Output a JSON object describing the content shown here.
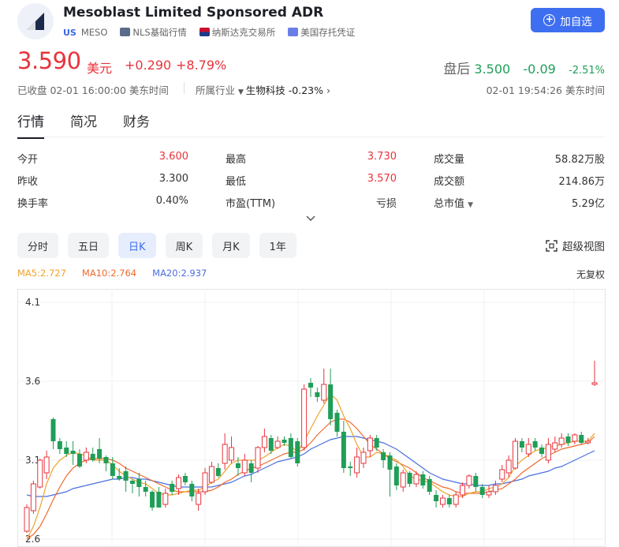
{
  "header": {
    "title": "Mesoblast Limited Sponsored ADR",
    "market_tag": "US",
    "ticker": "MESO",
    "tags": [
      "NLS基础行情",
      "纳斯达克交易所",
      "美国存托凭证"
    ],
    "fav_label": "加自选",
    "accent_color": "#3e6ff1"
  },
  "quote": {
    "price": "3.590",
    "unit": "美元",
    "change": "+0.290",
    "change_pct": "+8.79%",
    "after_label": "盘后",
    "after_price": "3.500",
    "after_change": "-0.09",
    "after_change_pct": "-2.51%",
    "closed_text": "已收盘 02-01 16:00:00 美东时间",
    "industry_label": "所属行业",
    "industry_name": "生物科技",
    "industry_change": "-0.23%",
    "after_time": "02-01 19:54:26 美东时间",
    "up_color": "#e8333c",
    "down_color": "#1f9e57"
  },
  "tabs": [
    "行情",
    "简况",
    "财务"
  ],
  "stats": [
    {
      "label": "今开",
      "value": "3.600"
    },
    {
      "label": "最高",
      "value": "3.730"
    },
    {
      "label": "成交量",
      "value": "58.82万股"
    },
    {
      "label": "昨收",
      "value": "3.300"
    },
    {
      "label": "最低",
      "value": "3.570"
    },
    {
      "label": "成交额",
      "value": "214.86万"
    },
    {
      "label": "换手率",
      "value": "0.40%"
    },
    {
      "label": "市盈(TTM)",
      "value": "亏损"
    },
    {
      "label": "总市值",
      "value": "5.29亿"
    }
  ],
  "periods": [
    "分时",
    "五日",
    "日K",
    "周K",
    "月K",
    "1年"
  ],
  "super_view": "超级视图",
  "ma": {
    "ma5": "MA5:2.727",
    "ma10": "MA10:2.764",
    "ma20": "MA20:2.937",
    "adjust": "无复权"
  },
  "chart_data": {
    "type": "candlestick",
    "y_ticks": [
      "4.1",
      "3.6",
      "3.1",
      "2.6"
    ],
    "ylim": [
      2.6,
      4.1
    ],
    "grid": true,
    "up_color": "#e8333c",
    "down_color": "#1f9e57",
    "ma_colors": {
      "ma5": "#f0a22b",
      "ma10": "#ef6a2d",
      "ma20": "#4b6fe0"
    },
    "candles": [
      [
        2.65,
        2.8,
        2.64,
        2.82
      ],
      [
        2.78,
        2.95,
        2.76,
        2.97
      ],
      [
        2.93,
        3.1,
        2.92,
        3.11
      ],
      [
        3.02,
        3.12,
        2.98,
        3.16
      ],
      [
        3.36,
        3.22,
        3.17,
        3.37
      ],
      [
        3.22,
        3.17,
        3.14,
        3.24
      ],
      [
        3.18,
        3.14,
        3.12,
        3.22
      ],
      [
        3.16,
        3.14,
        3.07,
        3.22
      ],
      [
        3.14,
        3.06,
        3.05,
        3.17
      ],
      [
        3.1,
        3.15,
        3.08,
        3.18
      ],
      [
        3.14,
        3.1,
        3.09,
        3.18
      ],
      [
        3.17,
        3.11,
        3.08,
        3.24
      ],
      [
        3.12,
        3.08,
        3.03,
        3.13
      ],
      [
        3.08,
        3.0,
        2.98,
        3.12
      ],
      [
        3.0,
        2.98,
        2.97,
        3.05
      ],
      [
        3.03,
        2.97,
        2.9,
        3.06
      ],
      [
        2.97,
        2.95,
        2.89,
        2.98
      ],
      [
        2.98,
        2.93,
        2.87,
        3.02
      ],
      [
        2.93,
        2.9,
        2.87,
        2.97
      ],
      [
        2.9,
        2.8,
        2.78,
        2.91
      ],
      [
        2.9,
        2.8,
        2.8,
        2.93
      ],
      [
        2.82,
        2.89,
        2.8,
        2.92
      ],
      [
        2.95,
        2.9,
        2.88,
        2.97
      ],
      [
        2.92,
        2.99,
        2.88,
        3.01
      ],
      [
        3.0,
        2.96,
        2.94,
        3.02
      ],
      [
        2.95,
        2.87,
        2.84,
        2.97
      ],
      [
        2.82,
        2.89,
        2.78,
        2.92
      ],
      [
        2.9,
        3.02,
        2.88,
        3.05
      ],
      [
        2.96,
        3.06,
        2.95,
        3.09
      ],
      [
        3.05,
        3.0,
        2.99,
        3.08
      ],
      [
        3.08,
        3.2,
        3.04,
        3.27
      ],
      [
        3.1,
        3.18,
        3.08,
        3.25
      ],
      [
        3.08,
        3.05,
        3.0,
        3.12
      ],
      [
        3.02,
        3.1,
        3.0,
        3.14
      ],
      [
        3.08,
        3.02,
        2.96,
        3.1
      ],
      [
        3.05,
        3.18,
        3.02,
        3.19
      ],
      [
        3.18,
        3.25,
        3.15,
        3.3
      ],
      [
        3.24,
        3.16,
        3.14,
        3.26
      ],
      [
        3.18,
        3.22,
        3.17,
        3.25
      ],
      [
        3.23,
        3.21,
        3.19,
        3.25
      ],
      [
        3.24,
        3.12,
        3.11,
        3.27
      ],
      [
        3.22,
        3.08,
        3.06,
        3.24
      ],
      [
        3.18,
        3.55,
        3.16,
        3.58
      ],
      [
        3.59,
        3.56,
        3.5,
        3.62
      ],
      [
        3.53,
        3.5,
        3.47,
        3.56
      ],
      [
        3.48,
        3.58,
        3.46,
        3.68
      ],
      [
        3.58,
        3.36,
        3.32,
        3.68
      ],
      [
        3.4,
        3.28,
        3.25,
        3.42
      ],
      [
        3.28,
        3.05,
        3.02,
        3.35
      ],
      [
        3.06,
        3.05,
        3.0,
        3.09
      ],
      [
        3.02,
        3.12,
        2.99,
        3.18
      ],
      [
        3.08,
        3.15,
        3.05,
        3.18
      ],
      [
        3.16,
        3.24,
        3.12,
        3.26
      ],
      [
        3.24,
        3.18,
        3.16,
        3.26
      ],
      [
        3.15,
        3.1,
        3.05,
        3.17
      ],
      [
        3.13,
        3.04,
        2.87,
        3.15
      ],
      [
        3.06,
        2.94,
        2.91,
        3.08
      ],
      [
        2.93,
        3.02,
        2.9,
        3.04
      ],
      [
        3.02,
        2.95,
        2.93,
        3.03
      ],
      [
        2.95,
        3.01,
        2.93,
        3.03
      ],
      [
        3.01,
        2.94,
        2.92,
        3.03
      ],
      [
        2.98,
        2.9,
        2.88,
        3.0
      ],
      [
        2.88,
        2.84,
        2.8,
        2.91
      ],
      [
        2.82,
        2.86,
        2.8,
        2.88
      ],
      [
        2.86,
        2.82,
        2.8,
        2.88
      ],
      [
        2.82,
        2.88,
        2.8,
        2.9
      ],
      [
        2.88,
        2.94,
        2.86,
        2.96
      ],
      [
        2.94,
        3.0,
        2.92,
        3.01
      ],
      [
        3.0,
        2.93,
        2.9,
        3.02
      ],
      [
        2.93,
        2.88,
        2.86,
        2.95
      ],
      [
        2.88,
        2.9,
        2.86,
        2.94
      ],
      [
        2.9,
        2.94,
        2.88,
        2.97
      ],
      [
        2.98,
        3.04,
        2.96,
        3.07
      ],
      [
        3.02,
        3.1,
        2.99,
        3.13
      ],
      [
        3.05,
        3.22,
        3.04,
        3.24
      ],
      [
        3.22,
        3.18,
        3.15,
        3.24
      ],
      [
        3.14,
        3.2,
        3.12,
        3.24
      ],
      [
        3.22,
        3.18,
        3.16,
        3.24
      ],
      [
        3.18,
        3.14,
        3.12,
        3.2
      ],
      [
        3.1,
        3.2,
        3.08,
        3.24
      ],
      [
        3.17,
        3.21,
        3.15,
        3.25
      ],
      [
        3.2,
        3.24,
        3.18,
        3.27
      ],
      [
        3.25,
        3.21,
        3.19,
        3.27
      ],
      [
        3.22,
        3.26,
        3.2,
        3.27
      ],
      [
        3.26,
        3.21,
        3.2,
        3.28
      ],
      [
        3.21,
        3.22,
        3.2,
        3.24
      ],
      [
        3.58,
        3.59,
        3.57,
        3.73
      ]
    ],
    "ma5": [
      2.6,
      2.68,
      2.8,
      2.95,
      3.05,
      3.1,
      3.13,
      3.15,
      3.14,
      3.13,
      3.1,
      3.1,
      3.1,
      3.07,
      3.03,
      3.0,
      2.98,
      2.96,
      2.95,
      2.92,
      2.89,
      2.88,
      2.88,
      2.89,
      2.9,
      2.91,
      2.91,
      2.93,
      2.96,
      2.98,
      3.03,
      3.08,
      3.1,
      3.1,
      3.1,
      3.1,
      3.12,
      3.15,
      3.18,
      3.2,
      3.19,
      3.15,
      3.22,
      3.3,
      3.38,
      3.45,
      3.52,
      3.48,
      3.38,
      3.3,
      3.2,
      3.12,
      3.12,
      3.15,
      3.14,
      3.12,
      3.1,
      3.06,
      3.0,
      2.98,
      2.97,
      2.96,
      2.93,
      2.9,
      2.88,
      2.87,
      2.87,
      2.89,
      2.9,
      2.9,
      2.92,
      2.93,
      2.95,
      2.99,
      3.06,
      3.1,
      3.13,
      3.16,
      3.17,
      3.18,
      3.19,
      3.2,
      3.21,
      3.22,
      3.22,
      3.22,
      3.27
    ],
    "ma10": [
      2.6,
      2.63,
      2.68,
      2.76,
      2.85,
      2.93,
      3.0,
      3.05,
      3.08,
      3.1,
      3.11,
      3.11,
      3.11,
      3.1,
      3.08,
      3.05,
      3.03,
      3.01,
      2.99,
      2.97,
      2.95,
      2.93,
      2.91,
      2.9,
      2.9,
      2.9,
      2.9,
      2.9,
      2.91,
      2.93,
      2.96,
      2.98,
      3.01,
      3.03,
      3.05,
      3.06,
      3.08,
      3.1,
      3.12,
      3.14,
      3.15,
      3.15,
      3.17,
      3.21,
      3.26,
      3.3,
      3.34,
      3.36,
      3.36,
      3.34,
      3.3,
      3.25,
      3.2,
      3.17,
      3.14,
      3.11,
      3.09,
      3.07,
      3.05,
      3.02,
      2.99,
      2.97,
      2.95,
      2.93,
      2.92,
      2.9,
      2.89,
      2.89,
      2.89,
      2.89,
      2.9,
      2.91,
      2.92,
      2.95,
      2.98,
      3.02,
      3.05,
      3.08,
      3.11,
      3.13,
      3.15,
      3.17,
      3.18,
      3.19,
      3.2,
      3.21,
      3.25
    ],
    "ma20": [
      2.88,
      2.87,
      2.87,
      2.87,
      2.88,
      2.89,
      2.9,
      2.92,
      2.93,
      2.94,
      2.95,
      2.96,
      2.97,
      2.98,
      2.98,
      2.99,
      2.99,
      2.98,
      2.98,
      2.97,
      2.96,
      2.95,
      2.94,
      2.93,
      2.93,
      2.93,
      2.93,
      2.93,
      2.93,
      2.94,
      2.95,
      2.96,
      2.98,
      3.0,
      3.01,
      3.03,
      3.05,
      3.07,
      3.09,
      3.1,
      3.11,
      3.12,
      3.14,
      3.17,
      3.19,
      3.21,
      3.23,
      3.24,
      3.25,
      3.25,
      3.25,
      3.24,
      3.23,
      3.22,
      3.21,
      3.19,
      3.17,
      3.14,
      3.11,
      3.08,
      3.05,
      3.02,
      3.0,
      2.98,
      2.97,
      2.96,
      2.95,
      2.95,
      2.94,
      2.94,
      2.94,
      2.95,
      2.95,
      2.96,
      2.97,
      2.98,
      3.0,
      3.01,
      3.02,
      3.03,
      3.05,
      3.06,
      3.08,
      3.1,
      3.12,
      3.14,
      3.16
    ]
  }
}
